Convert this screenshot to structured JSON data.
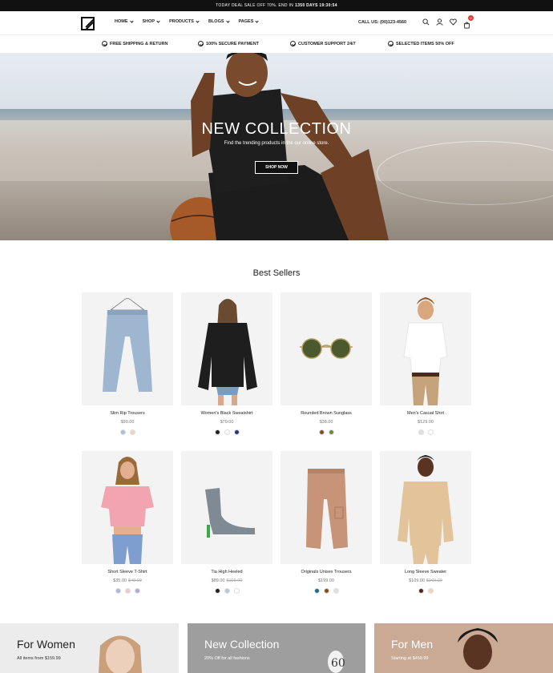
{
  "topbar": {
    "text": "TODAY DEAL SALE OFF 70%. END IN",
    "timer": "1350 DAYS 19:30:54"
  },
  "header": {
    "nav": [
      "HOME",
      "SHOP",
      "PRODUCTS",
      "BLOGS",
      "PAGES"
    ],
    "call": "CALL US: (00)123-4560",
    "icons": [
      "search-icon",
      "user-icon",
      "heart-icon",
      "cart-icon"
    ],
    "cart_count": "0"
  },
  "features": [
    "FREE SHIPPING & RETURN",
    "100% SECURE PAYMENT",
    "CUSTOMER SUPPORT 24/7",
    "SELECTED ITEMS 50% OFF"
  ],
  "hero": {
    "title": "NEW COLLECTION",
    "subtitle": "Find the trending products in the our online store.",
    "button": "SHOP NOW"
  },
  "best_sellers": {
    "title": "Best Sellers",
    "products": [
      {
        "name": "Slim Rip Trousers",
        "price": "$90.00",
        "old": "",
        "swatches": [
          "#a9bfd9",
          "#f0d3bd"
        ]
      },
      {
        "name": "Women's Black Sweatshirt",
        "price": "$70.00",
        "old": "",
        "swatches": [
          "#222222",
          "#ffffff",
          "#1f3a7a"
        ]
      },
      {
        "name": "Rounded Brown Sunglass",
        "price": "$38.00",
        "old": "",
        "swatches": [
          "#8a4a1f",
          "#6f8a2e"
        ]
      },
      {
        "name": "Men's Casual Shirt",
        "price": "$129.00",
        "old": "",
        "swatches": [
          "#e0e0e0",
          "#ffffff"
        ]
      },
      {
        "name": "Short Sleeve T-Shirt",
        "price": "$35.00",
        "old": "$49.00",
        "swatches": [
          "#a8b8e0",
          "#f3c8d3",
          "#b3a8e0"
        ]
      },
      {
        "name": "Tia High Heeled",
        "price": "$89.00",
        "old": "$109.00",
        "swatches": [
          "#222222",
          "#b8c8d8",
          "#ffffff"
        ]
      },
      {
        "name": "Originals Unisex Trousers",
        "price": "$199.00",
        "old": "",
        "swatches": [
          "#1f6b8a",
          "#8a4a1f",
          "#e0e0e0"
        ]
      },
      {
        "name": "Long Sleeve Sweater",
        "price": "$109.00",
        "old": "$169.00",
        "swatches": [
          "#4a2a1f",
          "#f0d3bd"
        ]
      }
    ]
  },
  "banners": [
    {
      "title": "For Women",
      "subtitle": "All items from $159.99"
    },
    {
      "title": "New Collection",
      "subtitle": "20% Off for all fashions"
    },
    {
      "title": "For Men",
      "subtitle": "Starting at $459.99"
    }
  ]
}
